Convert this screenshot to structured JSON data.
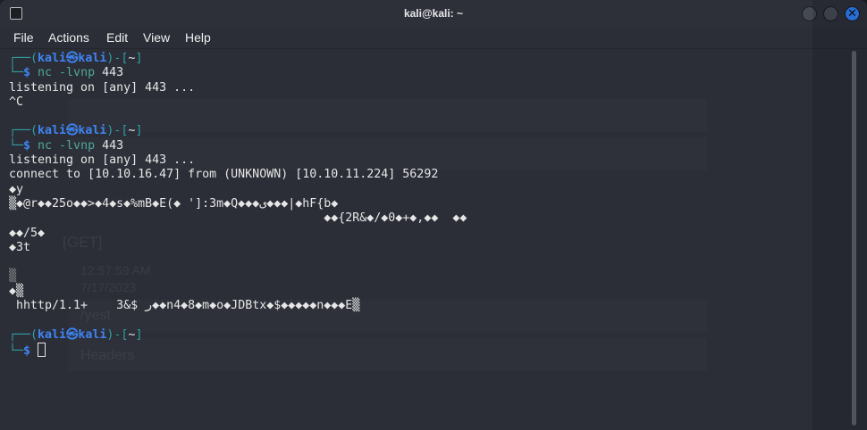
{
  "window": {
    "title": "kali@kali: ~"
  },
  "menu": [
    "File",
    "Actions",
    "Edit",
    "View",
    "Help"
  ],
  "background_ghost": {
    "method": "[GET]",
    "time": "12:57:59 AM",
    "date": "7/17/2023",
    "path": "/yest",
    "section": "Headers"
  },
  "prompt": {
    "user": "kali",
    "at": "㉿",
    "host": "kali",
    "dir": "~"
  },
  "terminal": {
    "cmd1": "nc -lvnp",
    "port1": "443",
    "out1": "listening on [any] 443 ...",
    "out2": "^C",
    "cmd2": "nc -lvnp",
    "port2": "443",
    "out3": "listening on [any] 443 ...",
    "out4": "connect to [10.10.16.47] from (UNKNOWN) [10.10.11.224] 56292",
    "out5": "◆y",
    "out6": "▒◆@r◆◆25o◆◆>◆4◆s◆%mB◆E(◆ ']:3m◆Q◆◆◆ى◆◆◆|◆hF{b◆",
    "out7": "                                            ◆◆{2R&◆/◆0◆+◆,◆◆  ◆◆",
    "out8": "◆◆/5◆",
    "out9": "◆3t",
    "out10": "▒",
    "out11": "◆▒",
    "out12": " hhttp/1.1+    3&$ ر◆◆n4◆8◆m◆o◆JDBtx◆$◆◆◆◆◆n◆◆◆E▒"
  },
  "colors": {
    "accent": "#2f7df2",
    "prompt_box": "#2f9fa3",
    "prompt_user": "#3f84f2",
    "command": "#4ea89a",
    "background": "#2b2e37"
  }
}
